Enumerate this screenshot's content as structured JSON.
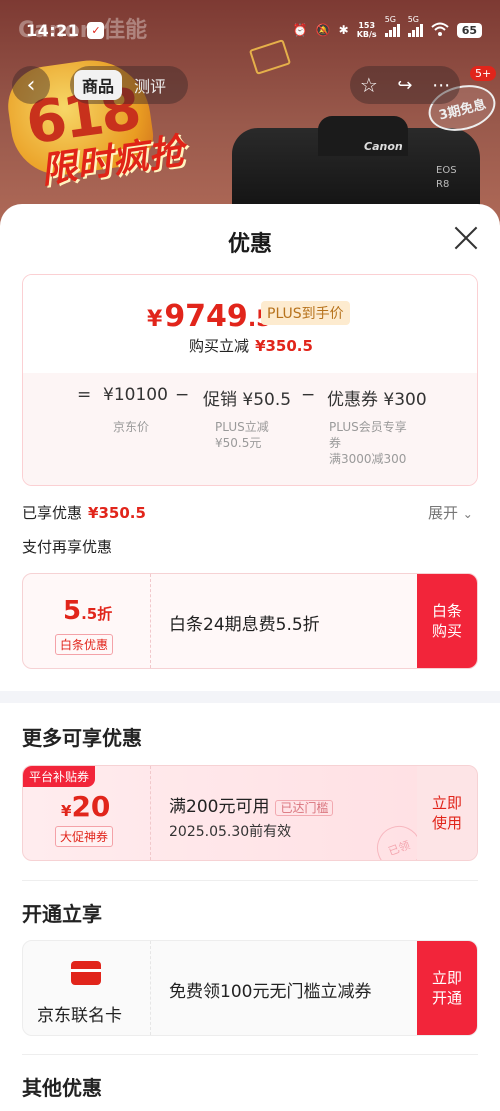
{
  "status_bar": {
    "time": "14:21",
    "net_speed_value": "153",
    "net_speed_unit": "KB/s",
    "signal1_label": "5G",
    "signal2_label": "5G",
    "battery": "65"
  },
  "background": {
    "brand": "Canon 佳能",
    "promo_618": "618",
    "promo_flash": "限时疯抢",
    "camera_logo": "Canon",
    "camera_model_line1": "EOS",
    "camera_model_line2": "R8",
    "stamp_text": "3期免息"
  },
  "nav": {
    "back_icon": "chevron-left-icon",
    "tabs": [
      {
        "label": "商品",
        "active": true
      },
      {
        "label": "测评",
        "active": false
      }
    ],
    "cart_badge": "5+"
  },
  "sheet": {
    "title": "优惠",
    "price": {
      "yen": "¥",
      "integer": "9749",
      "decimal": ".5",
      "plus_tag": "PLUS到手价",
      "buy_reduce_label": "购买立减",
      "buy_reduce_value": "¥350.5"
    },
    "formula": {
      "eq": "=",
      "jd_price": "¥10100",
      "jd_price_label": "京东价",
      "minus1": "−",
      "promo": "促销 ¥50.5",
      "promo_label_line1": "PLUS立减",
      "promo_label_line2": "¥50.5元",
      "minus2": "−",
      "coupon": "优惠券 ¥300",
      "coupon_label_line1": "PLUS会员专享",
      "coupon_label_line2": "券",
      "coupon_label_line3": "满3000减300"
    },
    "enjoyed_label": "已享优惠",
    "enjoyed_value": "¥350.5",
    "expand_label": "展开",
    "pay_again_label": "支付再享优惠",
    "baitiao": {
      "discount_main": "5",
      "discount_sub": ".5折",
      "tag": "白条优惠",
      "desc": "白条24期息费5.5折",
      "action": "白条购买"
    },
    "more_title": "更多可享优惠",
    "platform_coupon": {
      "flag": "平台补贴券",
      "yen": "¥",
      "amount": "20",
      "tag": "大促神券",
      "condition": "满200元可用",
      "cond_tag": "已达门槛",
      "valid": "2025.05.30前有效",
      "action": "立即使用",
      "got_stamp": "已领"
    },
    "open_title": "开通立享",
    "jd_card": {
      "name": "京东联名卡",
      "desc": "免费领100元无门槛立减券",
      "action": "立即开通"
    },
    "other_title": "其他优惠"
  }
}
